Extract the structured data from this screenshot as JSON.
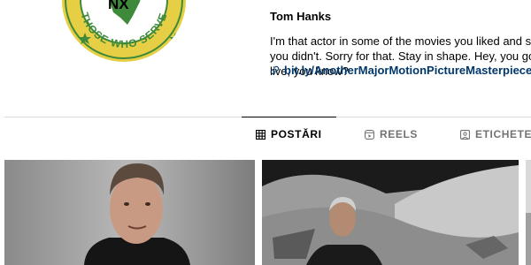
{
  "profile": {
    "avatar_text_top": "NX",
    "avatar_text_ring": "THOSE WHO SERVE",
    "avatar_colors": {
      "ring": "#e7cf45",
      "inner": "#ffffff",
      "green": "#3f8a3a"
    },
    "username": "Tom Hanks",
    "bio": "I'm that actor in some of the movies you liked and some you didn't. Sorry for that. Stay in shape. Hey, you gotta live, you know?",
    "link": "bit.ly/AnotherMajorMotionPictureMasterpiece",
    "link_icon": "link-icon"
  },
  "tabs": [
    {
      "label": "POSTĂRI",
      "icon": "grid-icon",
      "active": true
    },
    {
      "label": "REELS",
      "icon": "reels-icon",
      "active": false
    },
    {
      "label": "ETICHETE",
      "icon": "tagged-icon",
      "active": false
    }
  ],
  "posts": [
    {
      "kind": "portrait-photo"
    },
    {
      "kind": "moon-landscape-photo"
    },
    {
      "kind": "partial-photo"
    }
  ],
  "colors": {
    "link": "#00376b",
    "muted": "#737373",
    "divider": "#dbdbdb"
  }
}
